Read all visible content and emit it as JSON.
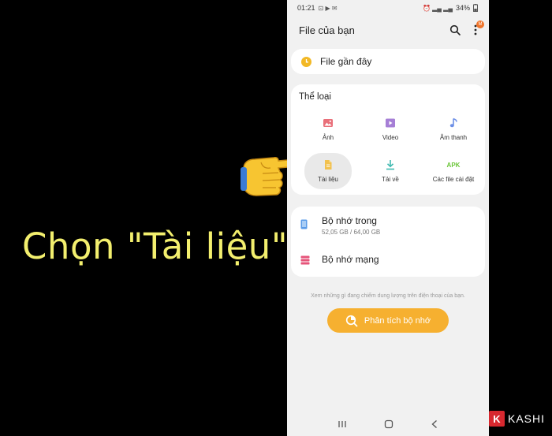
{
  "caption": "Chọn \"Tài liệu\"",
  "status": {
    "time": "01:21",
    "battery": "34%"
  },
  "appbar": {
    "title": "File của bạn",
    "badge": "M"
  },
  "recent": {
    "label": "File gần đây"
  },
  "categories": {
    "title": "Thể loại",
    "items": [
      {
        "label": "Ảnh",
        "icon": "image-icon",
        "color": "#e9707a"
      },
      {
        "label": "Video",
        "icon": "video-icon",
        "color": "#a67fd6"
      },
      {
        "label": "Âm thanh",
        "icon": "music-note-icon",
        "color": "#6d8fe6"
      },
      {
        "label": "Tài liệu",
        "icon": "document-icon",
        "color": "#f2c14e"
      },
      {
        "label": "Tải về",
        "icon": "download-icon",
        "color": "#3fb9b0"
      },
      {
        "label": "Các file cài đặt",
        "icon": "apk-icon",
        "icon_text": "APK",
        "color": "#6cc63a"
      }
    ]
  },
  "storage": {
    "internal": {
      "name": "Bộ nhớ trong",
      "usage": "52,05 GB / 64,00 GB"
    },
    "network": {
      "name": "Bộ nhớ mạng"
    }
  },
  "hint": "Xem những gì đang chiếm dung lượng trên điện thoại của bạn.",
  "analyze": {
    "label": "Phân tích bộ nhớ"
  },
  "logo": {
    "letter": "K",
    "text": "KASHI"
  }
}
